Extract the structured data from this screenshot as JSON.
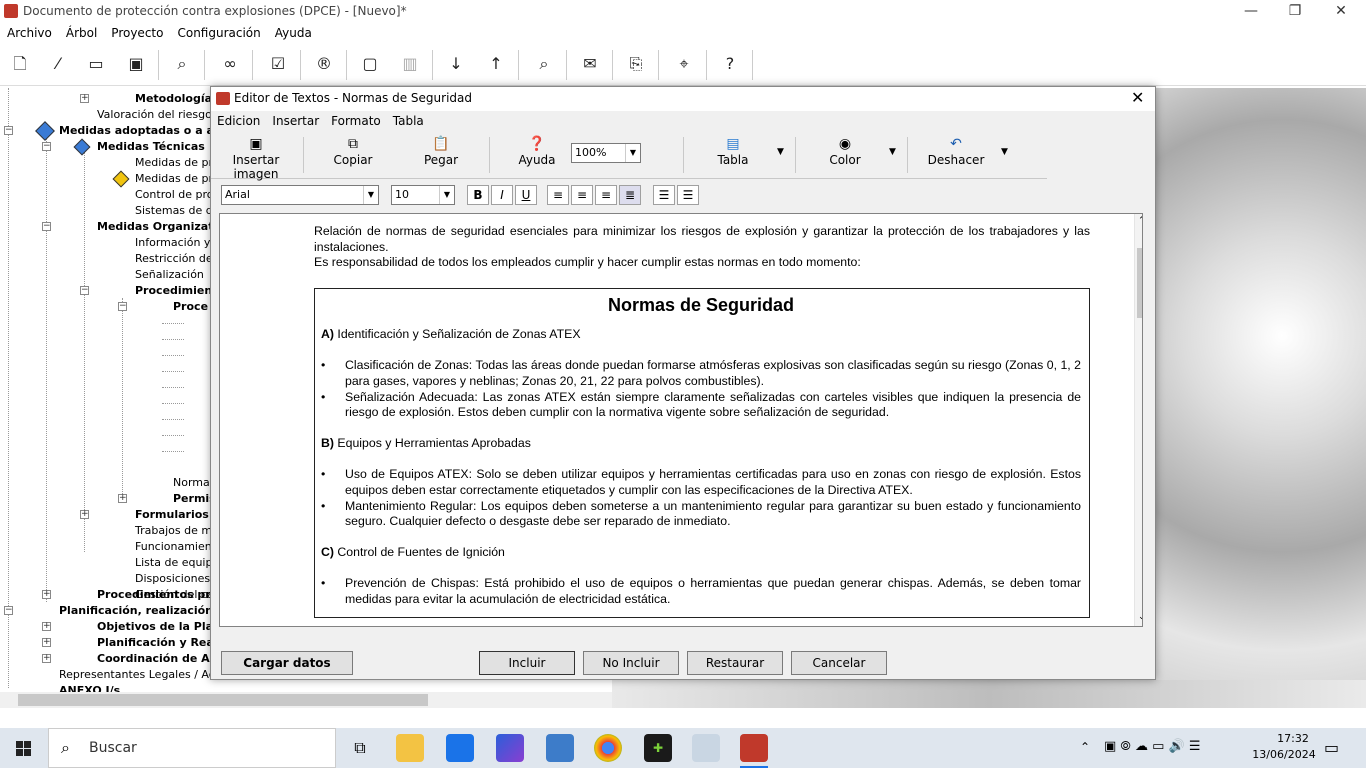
{
  "window": {
    "title": "Documento de protección contra explosiones (DPCE) - [Nuevo]*",
    "minimize_glyph": "—",
    "restore_glyph": "❐",
    "close_glyph": "✕"
  },
  "menubar": [
    "Archivo",
    "Árbol",
    "Proyecto",
    "Configuración",
    "Ayuda"
  ],
  "toolbar_icons": [
    "new-icon",
    "wand-icon",
    "open-folder-icon",
    "save-icon",
    "preview-icon",
    "binoculars-icon",
    "checkbox-icon",
    "report-icon",
    "comment-icon",
    "trash-icon",
    "sort-asc-icon",
    "sort-desc-icon",
    "search-doc-icon",
    "mail-icon",
    "pdf-icon",
    "location-icon",
    "help-icon"
  ],
  "tree": {
    "items": [
      {
        "label": "Metodología",
        "bold": true
      },
      {
        "label": "Valoración del riesgo, e",
        "bold": false
      },
      {
        "label": "Medidas adoptadas o a ad",
        "bold": true
      },
      {
        "label": "Medidas Técnicas",
        "bold": true
      },
      {
        "label": "Medidas de pre",
        "bold": false
      },
      {
        "label": "Medidas de pro",
        "bold": false
      },
      {
        "label": "Control de proc",
        "bold": false
      },
      {
        "label": "Sistemas de det",
        "bold": false
      },
      {
        "label": "Medidas Organizativ",
        "bold": true
      },
      {
        "label": "Información y fo",
        "bold": false
      },
      {
        "label": "Restricción del",
        "bold": false
      },
      {
        "label": "Señalización",
        "bold": false
      },
      {
        "label": "Procedimient",
        "bold": true
      },
      {
        "label": "Proce",
        "bold": true
      },
      {
        "label": "Normas",
        "bold": false
      },
      {
        "label": "Permis",
        "bold": true
      },
      {
        "label": "Formularios",
        "bold": true
      },
      {
        "label": "Trabajos de ma",
        "bold": false
      },
      {
        "label": "Funcionamiento",
        "bold": false
      },
      {
        "label": "Lista de equipos",
        "bold": false
      },
      {
        "label": "Disposiciones p",
        "bold": false
      },
      {
        "label": "Gestión del cam",
        "bold": false
      },
      {
        "label": "Procedimientos prev",
        "bold": true
      },
      {
        "label": "Planificación, realización y",
        "bold": true
      },
      {
        "label": "Objetivos de la Plan",
        "bold": true
      },
      {
        "label": "Planificación y Real",
        "bold": true
      },
      {
        "label": "Coordinación de Ac",
        "bold": true
      },
      {
        "label": "Representantes Legales / Admi",
        "bold": false
      },
      {
        "label": "ANEXO I/s",
        "bold": true
      }
    ]
  },
  "dialog": {
    "title": "Editor de Textos - Normas de Seguridad",
    "close_glyph": "✕",
    "menu": [
      "Edicion",
      "Insertar",
      "Formato",
      "Tabla"
    ],
    "tools": {
      "insert_image": "Insertar imagen",
      "copy": "Copiar",
      "paste": "Pegar",
      "help": "Ayuda",
      "zoom": "100%",
      "table": "Tabla",
      "color": "Color",
      "undo": "Deshacer"
    },
    "format": {
      "font": "Arial",
      "size": "10",
      "bold": "B",
      "italic": "I",
      "underline": "U"
    },
    "document": {
      "intro1": "Relación de normas de seguridad esenciales para minimizar los riesgos de explosión y garantizar la protección de los trabajadores y las instalaciones.",
      "intro2": "Es responsabilidad de todos los empleados cumplir y hacer cumplir estas normas en todo momento:",
      "heading": "Normas de Seguridad",
      "sections": [
        {
          "letter": "A)",
          "title": " Identificación y Señalización de Zonas ATEX",
          "bullets": [
            "Clasificación de Zonas: Todas las áreas donde puedan formarse atmósferas explosivas son clasificadas según su riesgo (Zonas 0, 1, 2 para gases, vapores y neblinas; Zonas 20, 21, 22 para polvos combustibles).",
            "Señalización Adecuada: Las zonas ATEX están siempre claramente señalizadas con carteles visibles que indiquen la presencia de riesgo de explosión. Estos deben cumplir con la normativa vigente sobre señalización de seguridad."
          ]
        },
        {
          "letter": "B)",
          "title": " Equipos y Herramientas Aprobadas",
          "bullets": [
            "Uso de Equipos ATEX: Solo se deben utilizar equipos y herramientas certificadas para uso en zonas con riesgo de explosión. Estos equipos deben estar correctamente etiquetados y cumplir con las especificaciones de la Directiva ATEX.",
            "Mantenimiento Regular: Los equipos deben someterse a un mantenimiento regular para garantizar su buen estado y funcionamiento seguro. Cualquier defecto o desgaste debe ser reparado de inmediato."
          ]
        },
        {
          "letter": "C)",
          "title": " Control de Fuentes de Ignición",
          "bullets": [
            "Prevención de Chispas: Está prohibido el uso de equipos o herramientas que puedan generar chispas. Además, se deben tomar medidas para evitar la acumulación de electricidad estática."
          ]
        }
      ]
    },
    "buttons": {
      "load": "Cargar datos",
      "include": "Incluir",
      "exclude": "No Incluir",
      "restore": "Restaurar",
      "cancel": "Cancelar"
    }
  },
  "taskbar": {
    "search": "Buscar",
    "time": "17:32",
    "date": "13/06/2024"
  }
}
